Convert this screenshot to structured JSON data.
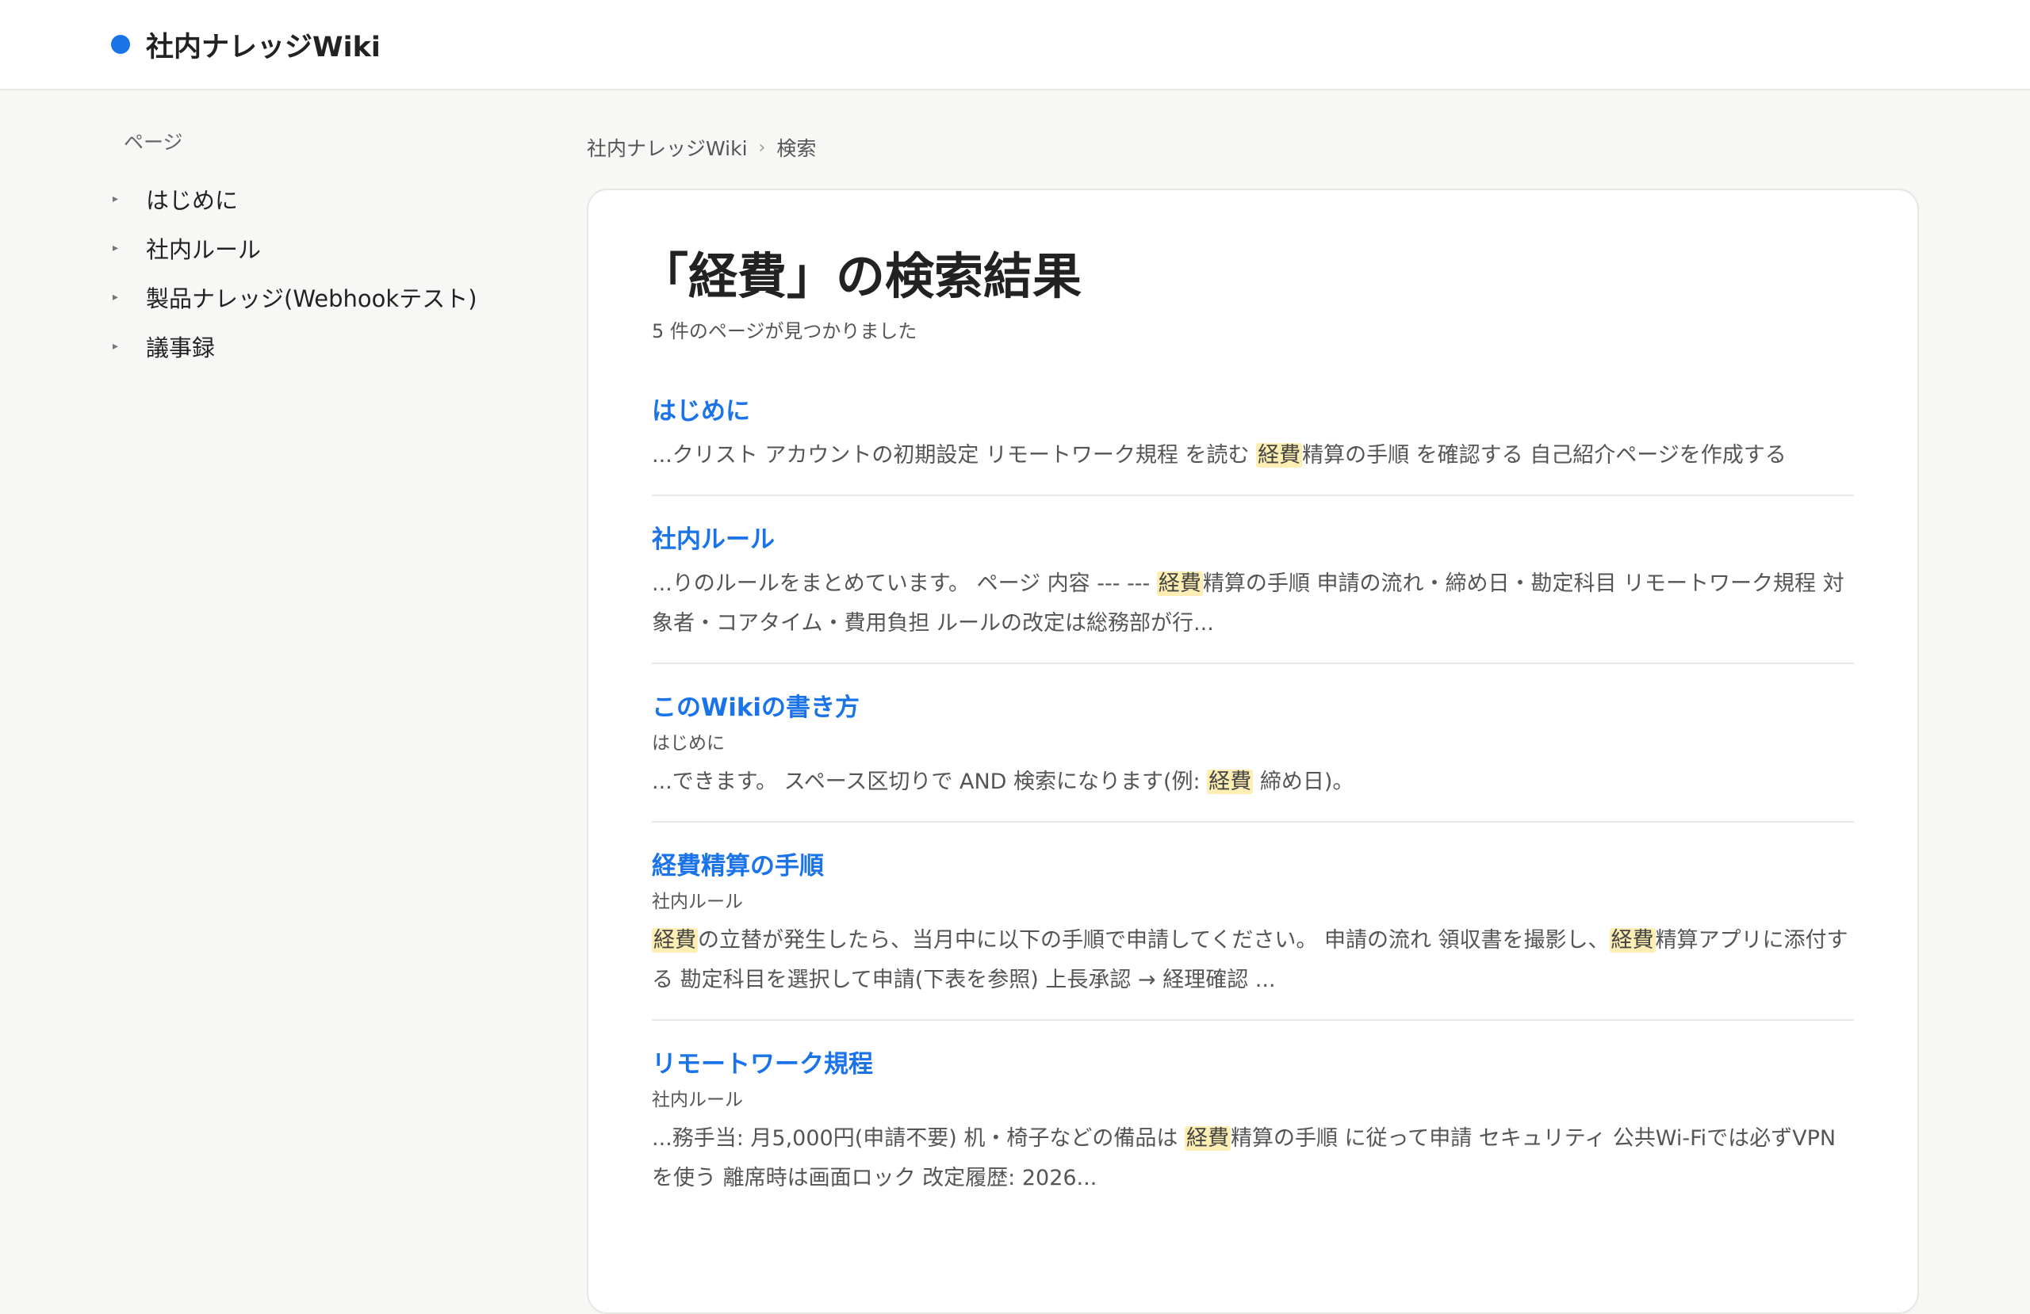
{
  "header": {
    "title": "社内ナレッジWiki",
    "accent_color": "#1a73e8"
  },
  "sidebar": {
    "heading": "ページ",
    "items": [
      {
        "label": "はじめに",
        "icon": "caret-right-icon"
      },
      {
        "label": "社内ルール",
        "icon": "caret-right-icon"
      },
      {
        "label": "製品ナレッジ(Webhookテスト)",
        "icon": "caret-right-icon"
      },
      {
        "label": "議事録",
        "icon": "caret-right-icon"
      }
    ]
  },
  "breadcrumb": {
    "root": "社内ナレッジWiki",
    "separator": "›",
    "current": "検索"
  },
  "search": {
    "title": "「経費」の検索結果",
    "count_text": "5 件のページが見つかりました",
    "highlight_color": "#fdefb3",
    "results": [
      {
        "title": "はじめに",
        "parent": "",
        "snippet": [
          {
            "t": "...クリスト アカウントの初期設定 リモートワーク規程 を読む "
          },
          {
            "t": "経費",
            "hl": true
          },
          {
            "t": "精算の手順 を確認する 自己紹介ページを作成する"
          }
        ]
      },
      {
        "title": "社内ルール",
        "parent": "",
        "snippet": [
          {
            "t": "...りのルールをまとめています。 ページ 内容 --- --- "
          },
          {
            "t": "経費",
            "hl": true
          },
          {
            "t": "精算の手順 申請の流れ・締め日・勘定科目 リモートワーク規程 対象者・コアタイム・費用負担 ルールの改定は総務部が行..."
          }
        ]
      },
      {
        "title": "このWikiの書き方",
        "parent": "はじめに",
        "snippet": [
          {
            "t": "...できます。 スペース区切りで AND 検索になります(例: "
          },
          {
            "t": "経費",
            "hl": true
          },
          {
            "t": " 締め日)。"
          }
        ]
      },
      {
        "title": "経費精算の手順",
        "parent": "社内ルール",
        "snippet": [
          {
            "t": "経費",
            "hl": true
          },
          {
            "t": "の立替が発生したら、当月中に以下の手順で申請してください。 申請の流れ 領収書を撮影し、"
          },
          {
            "t": "経費",
            "hl": true
          },
          {
            "t": "精算アプリに添付する 勘定科目を選択して申請(下表を参照) 上長承認 → 経理確認 ..."
          }
        ]
      },
      {
        "title": "リモートワーク規程",
        "parent": "社内ルール",
        "snippet": [
          {
            "t": "...務手当: 月5,000円(申請不要) 机・椅子などの備品は "
          },
          {
            "t": "経費",
            "hl": true
          },
          {
            "t": "精算の手順 に従って申請 セキュリティ 公共Wi-Fiでは必ずVPNを使う 離席時は画面ロック 改定履歴: 2026..."
          }
        ]
      }
    ]
  }
}
